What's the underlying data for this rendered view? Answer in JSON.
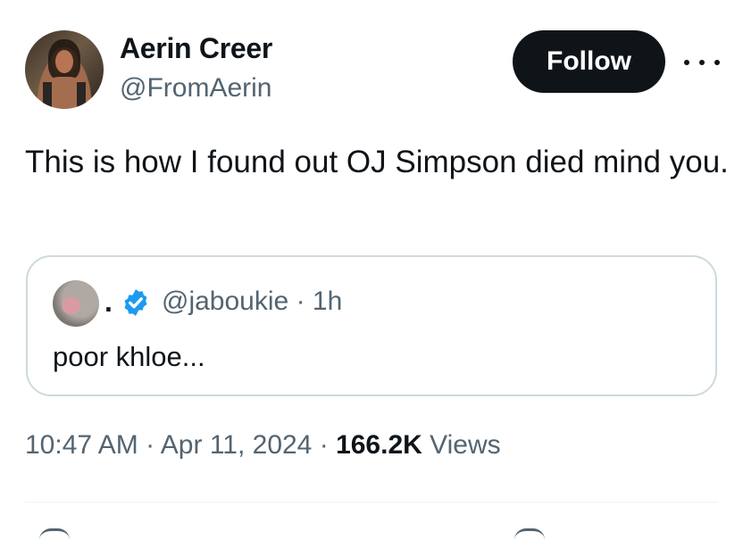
{
  "tweet": {
    "author": {
      "name": "Aerin Creer",
      "handle": "@FromAerin"
    },
    "follow_label": "Follow",
    "more_icon": "more-horizontal-icon",
    "text": "This is how I found out OJ Simpson died mind you.",
    "quote": {
      "name": ".",
      "verified_icon": "verified-badge-icon",
      "verified_color": "#1d9bf0",
      "handle": "@jaboukie",
      "separator": "·",
      "time": "1h",
      "text": "poor khloe..."
    },
    "meta": {
      "time": "10:47 AM",
      "sep1": "·",
      "date": "Apr 11, 2024",
      "sep2": "·",
      "views_count": "166.2K",
      "views_label": "Views"
    }
  }
}
